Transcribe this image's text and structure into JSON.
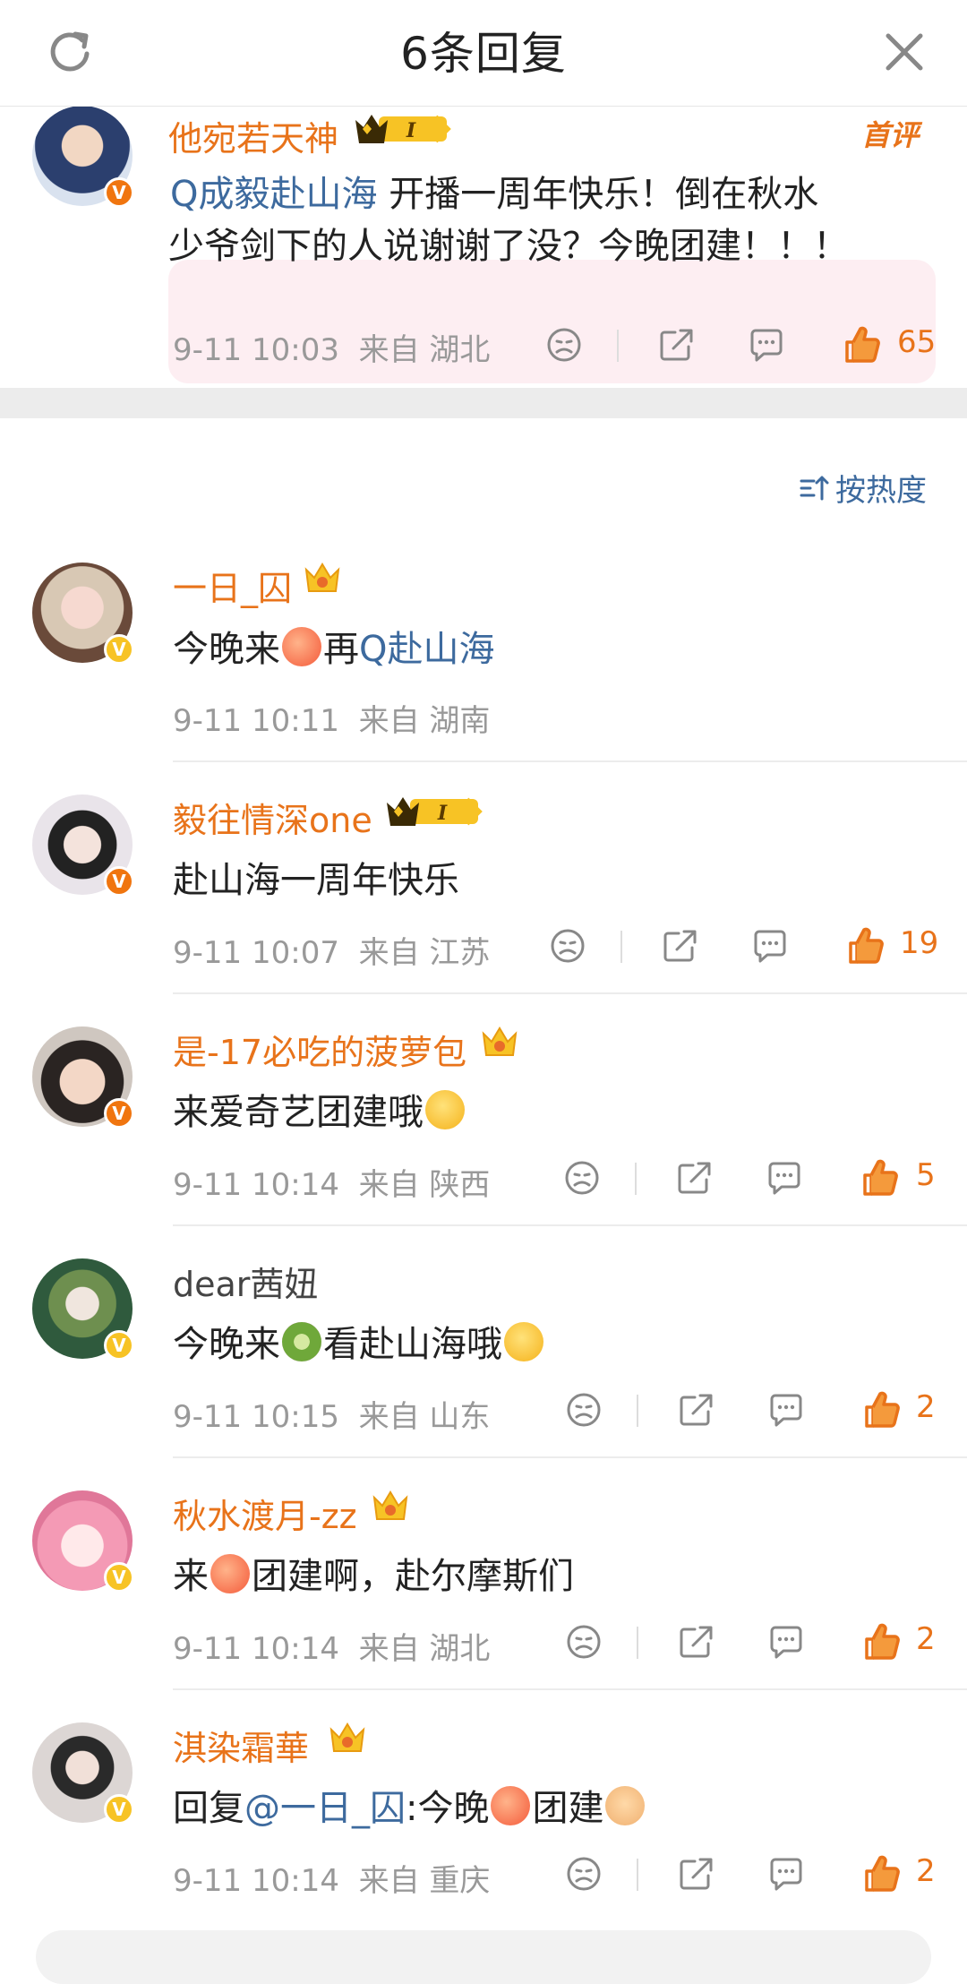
{
  "header": {
    "title": "6条回复"
  },
  "main_post": {
    "username": "他宛若天神",
    "badge": "首评",
    "topic": "Q成毅赴山海",
    "text_line1": "开播一周年快乐！倒在秋水",
    "text_line2": "少爷剑下的人说谢谢了没？今晚团建！！！",
    "time": "9-11 10:03",
    "from": "来自 湖北",
    "likes": "65"
  },
  "sort": {
    "label": "按热度"
  },
  "replies": [
    {
      "username": "一日_囚",
      "content_pre": "今晚来",
      "content_mid": "再",
      "topic": "Q赴山海",
      "time": "9-11 10:11",
      "from": "来自 湖南",
      "likes": ""
    },
    {
      "username": "毅往情深one",
      "content": "赴山海一周年快乐",
      "time": "9-11 10:07",
      "from": "来自 江苏",
      "likes": "19"
    },
    {
      "username": "是-17必吃的菠萝包",
      "content": "来爱奇艺团建哦",
      "time": "9-11 10:14",
      "from": "来自 陕西",
      "likes": "5"
    },
    {
      "username": "dear茜妞",
      "content_pre": "今晚来",
      "content_post": "看赴山海哦",
      "time": "9-11 10:15",
      "from": "来自 山东",
      "likes": "2"
    },
    {
      "username": "秋水渡月-zz",
      "content_pre": "来",
      "content_post": "团建啊，赴尔摩斯们",
      "time": "9-11 10:14",
      "from": "来自 湖北",
      "likes": "2"
    },
    {
      "username": "淇染霜華",
      "reply_prefix": "回复",
      "mention": "@一日_囚",
      "content_pre": ":今晚",
      "content_post": "团建",
      "time": "9-11 10:14",
      "from": "来自 重庆",
      "likes": "2"
    }
  ],
  "colors": {
    "accent": "#e8731a",
    "link": "#3d6a9e",
    "muted": "#999999"
  }
}
